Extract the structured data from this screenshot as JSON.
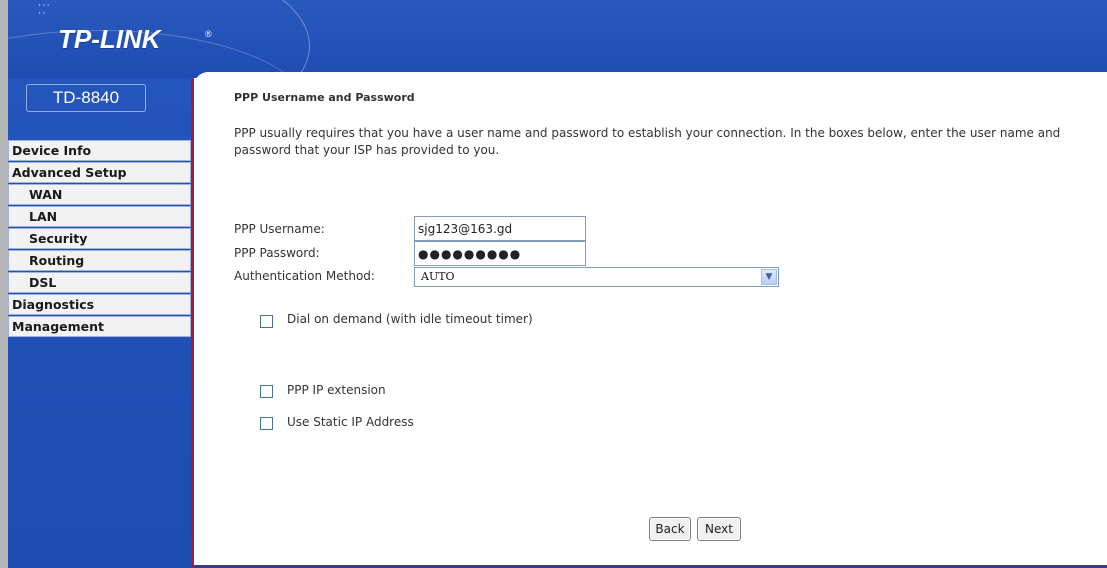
{
  "brand": {
    "logo": "TP-LINK",
    "model": "TD-8840"
  },
  "sidebar": {
    "items": [
      {
        "label": "Device Info",
        "level": 0
      },
      {
        "label": "Advanced Setup",
        "level": 0
      },
      {
        "label": "WAN",
        "level": 1
      },
      {
        "label": "LAN",
        "level": 1
      },
      {
        "label": "Security",
        "level": 1
      },
      {
        "label": "Routing",
        "level": 1
      },
      {
        "label": "DSL",
        "level": 1
      },
      {
        "label": "Diagnostics",
        "level": 0
      },
      {
        "label": "Management",
        "level": 0
      }
    ]
  },
  "page": {
    "title": "PPP Username and Password",
    "description": "PPP usually requires that you have a user name and password to establish your connection. In the boxes below, enter the user name and password that your ISP has provided to you."
  },
  "form": {
    "username_label": "PPP Username:",
    "username_value": "sjg123@163.gd",
    "password_label": "PPP Password:",
    "password_value": "●●●●●●●●●",
    "auth_label": "Authentication Method:",
    "auth_value": "AUTO",
    "dial_on_demand_label": "Dial on demand (with idle timeout timer)",
    "dial_on_demand_checked": false,
    "ip_extension_label": "PPP IP extension",
    "ip_extension_checked": false,
    "static_ip_label": "Use Static IP Address",
    "static_ip_checked": false
  },
  "buttons": {
    "back": "Back",
    "next": "Next"
  },
  "colors": {
    "banner": "#1e4cb3",
    "sidebar_border": "#9a1f3a",
    "menu_bg": "#f2f2f2"
  },
  "icons": {
    "select_arrow": "chevron-down-icon"
  }
}
